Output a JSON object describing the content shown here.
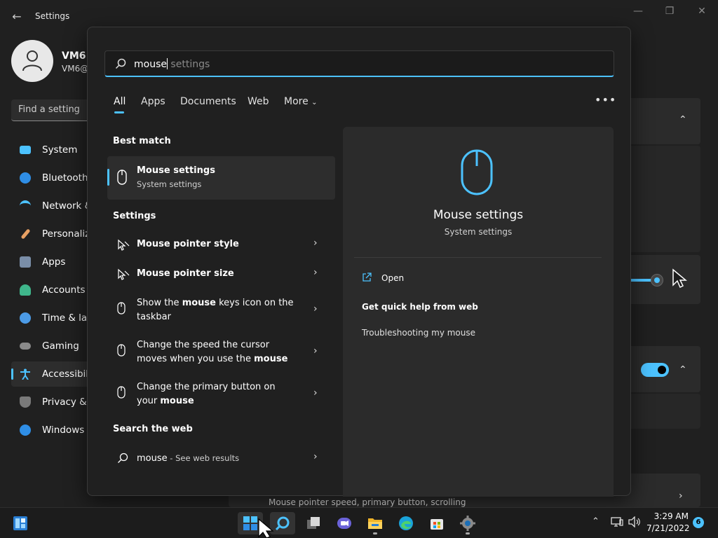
{
  "window": {
    "title": "Settings",
    "user_name": "VM6",
    "user_email": "VM6@",
    "find_placeholder": "Find a setting",
    "nav": [
      {
        "label": "System",
        "color": "#4cc2ff"
      },
      {
        "label": "Bluetooth",
        "color": "#2f8ee6"
      },
      {
        "label": "Network &",
        "color": "#4cc2ff"
      },
      {
        "label": "Personaliz",
        "color": "#e8a063"
      },
      {
        "label": "Apps",
        "color": "#7a8ea8"
      },
      {
        "label": "Accounts",
        "color": "#3fb68b"
      },
      {
        "label": "Time & lar",
        "color": "#4c9be6"
      },
      {
        "label": "Gaming",
        "color": "#8a8a8a"
      },
      {
        "label": "Accessibilit",
        "color": "#4cc2ff"
      },
      {
        "label": "Privacy & s",
        "color": "#7a7a7a"
      },
      {
        "label": "Windows U",
        "color": "#2f8ee6"
      }
    ],
    "bottom_card_text": "Mouse pointer speed, primary button, scrolling"
  },
  "search": {
    "query": "mouse",
    "suggestion": " settings",
    "tabs": [
      "All",
      "Apps",
      "Documents",
      "Web",
      "More"
    ],
    "more_dots": "•••",
    "best_match_heading": "Best match",
    "best_match": {
      "title": "Mouse settings",
      "subtitle": "System settings"
    },
    "settings_heading": "Settings",
    "settings_results": [
      {
        "before": "",
        "bold": "Mouse",
        "after": " pointer style",
        "bold_all": true
      },
      {
        "before": "",
        "bold": "Mouse",
        "after": " pointer size",
        "bold_all": true
      },
      {
        "before": "Show the ",
        "bold": "mouse",
        "after": " keys icon on the taskbar",
        "bold_all": false
      },
      {
        "before": "Change the speed the cursor moves when you use the ",
        "bold": "mouse",
        "after": "",
        "bold_all": false
      },
      {
        "before": "Change the primary button on your ",
        "bold": "mouse",
        "after": "",
        "bold_all": false
      }
    ],
    "web_heading": "Search the web",
    "web_query": "mouse",
    "web_suffix": " - See web results"
  },
  "preview": {
    "title": "Mouse settings",
    "subtitle": "System settings",
    "open_label": "Open",
    "help_label": "Get quick help from web",
    "trouble_label": "Troubleshooting my mouse"
  },
  "taskbar": {
    "time": "3:29 AM",
    "date": "7/21/2022",
    "notification_count": "6"
  },
  "accent": "#4cc2ff"
}
